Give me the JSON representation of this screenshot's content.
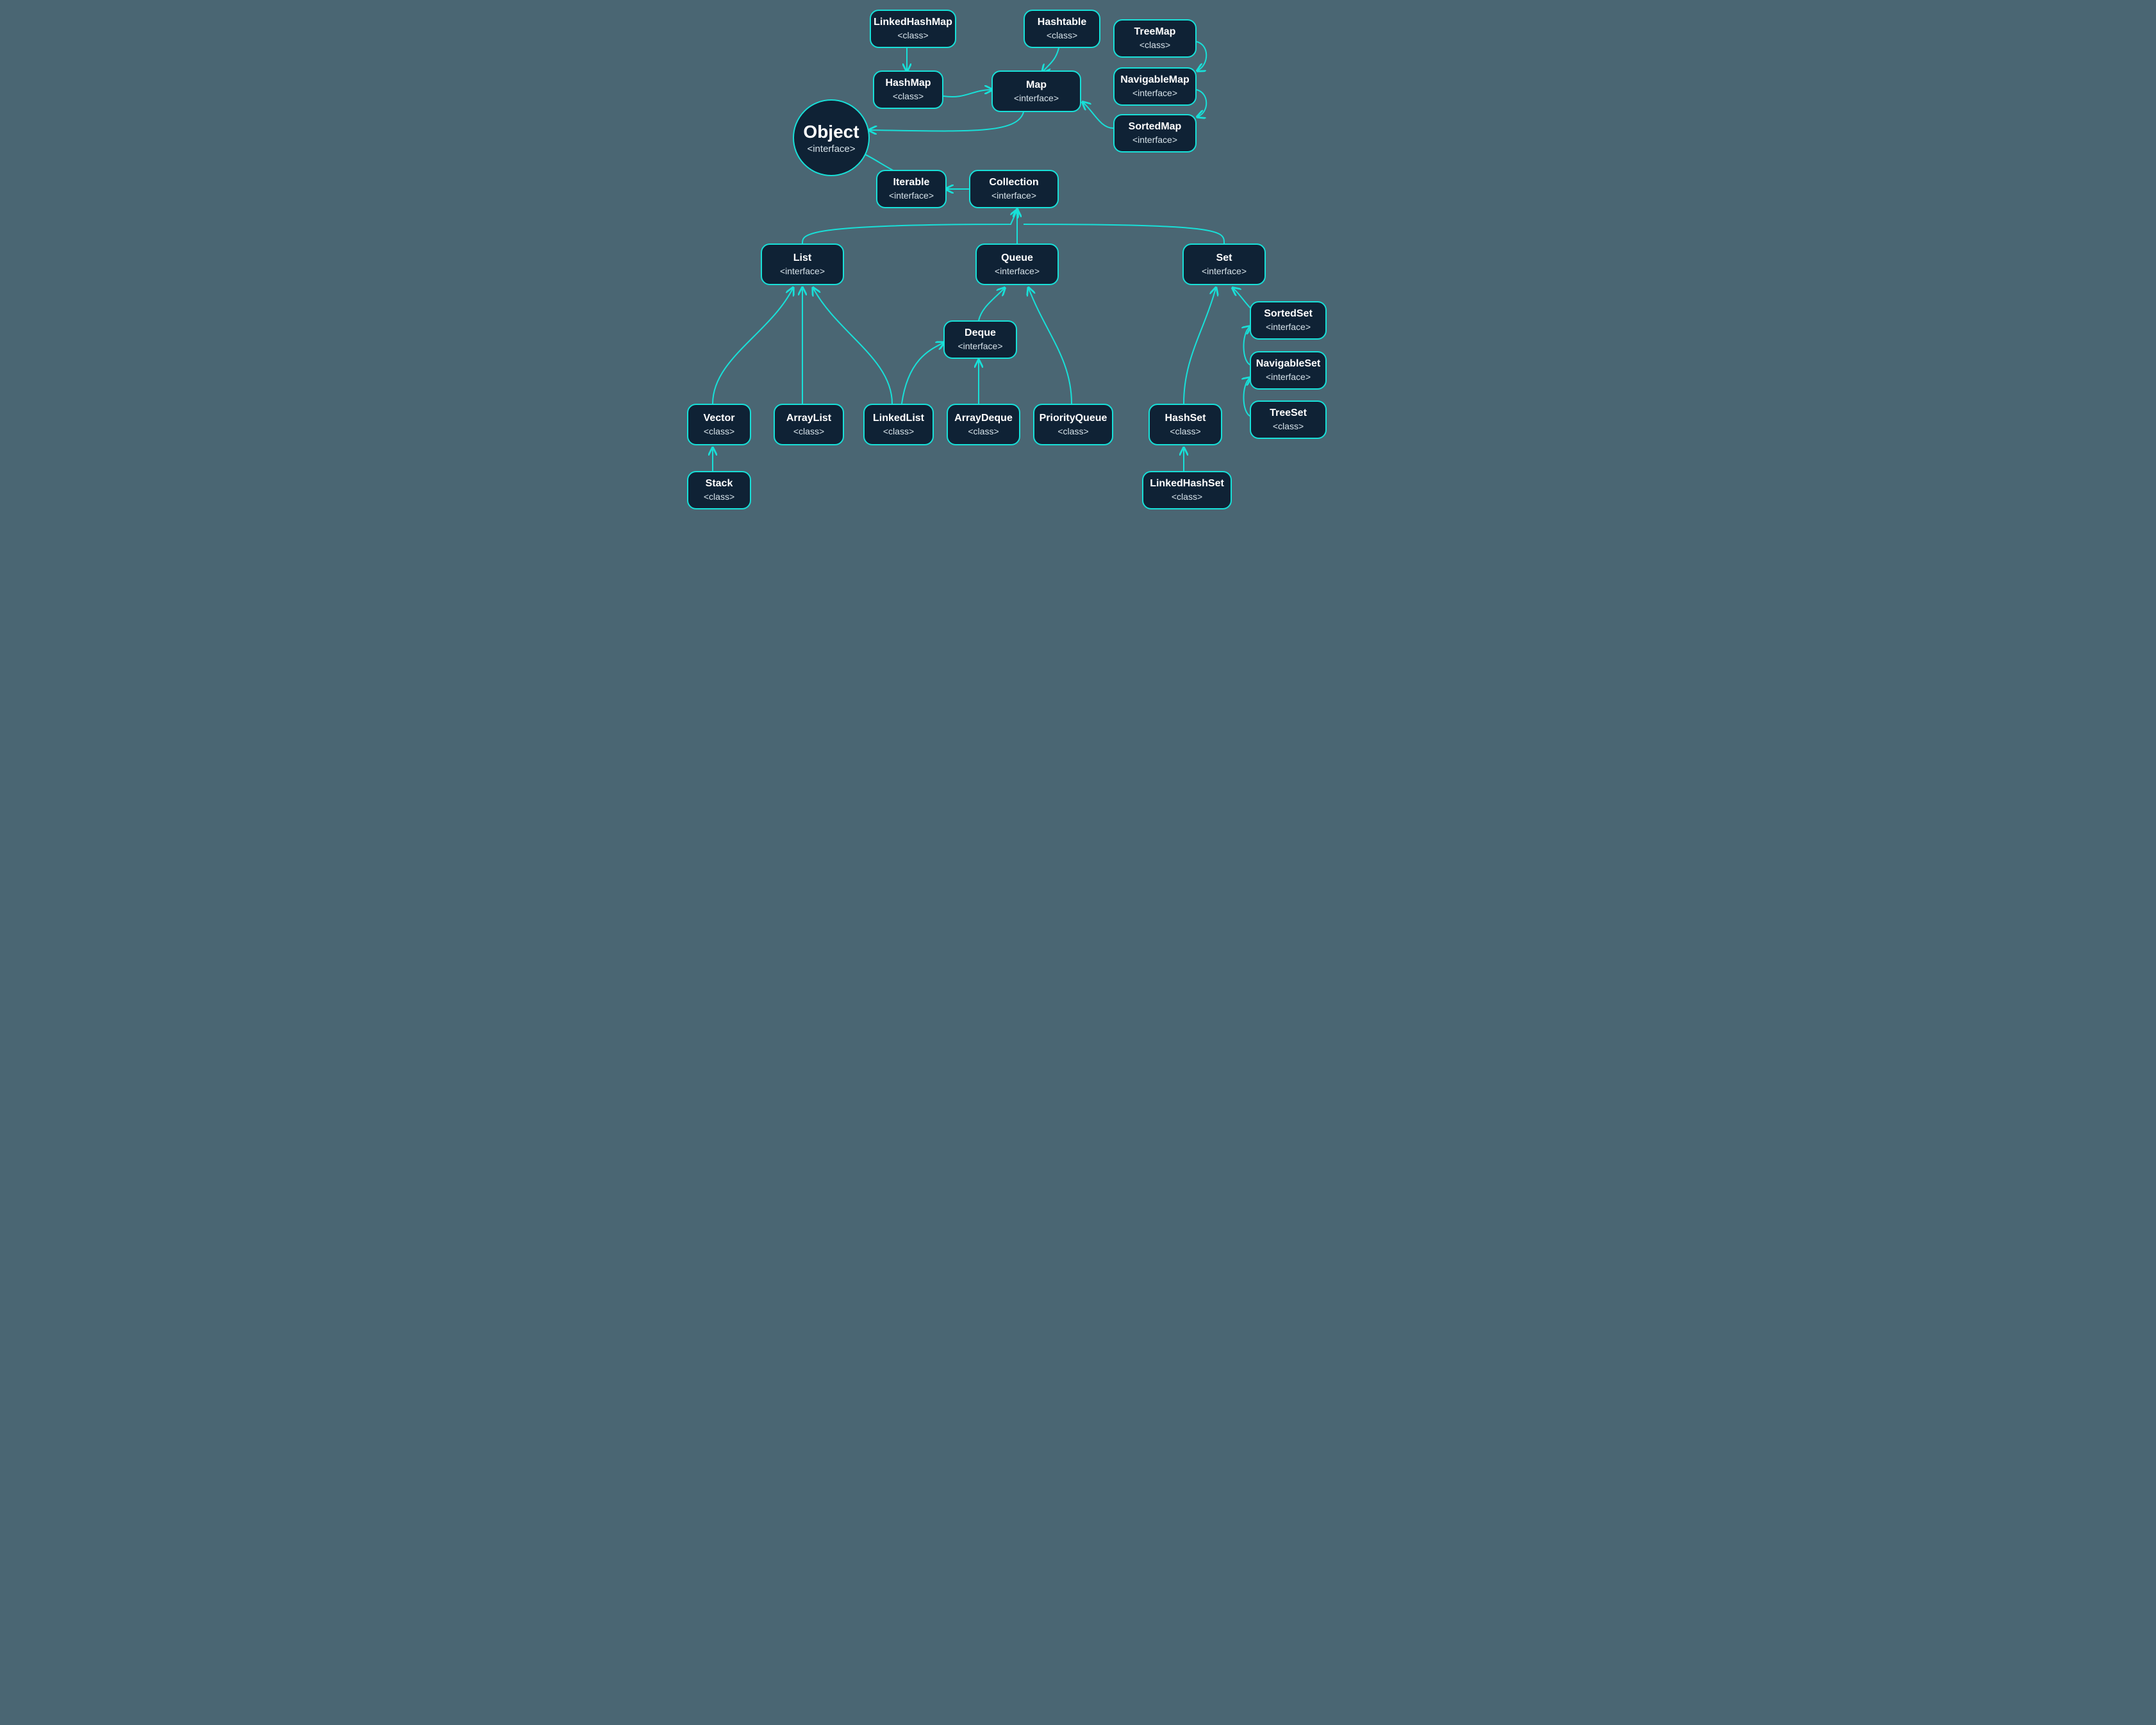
{
  "colors": {
    "bg": "#4a6673",
    "nodeFill": "#0f2235",
    "accent": "#18e0d8"
  },
  "rootCircle": {
    "title": "Object",
    "stereo": "<interface>"
  },
  "nodes": {
    "linkedHashMap": {
      "title": "LinkedHashMap",
      "stereo": "<class>"
    },
    "hashMap": {
      "title": "HashMap",
      "stereo": "<class>"
    },
    "hashtable": {
      "title": "Hashtable",
      "stereo": "<class>"
    },
    "map": {
      "title": "Map",
      "stereo": "<interface>"
    },
    "treeMap": {
      "title": "TreeMap",
      "stereo": "<class>"
    },
    "navigableMap": {
      "title": "NavigableMap",
      "stereo": "<interface>"
    },
    "sortedMap": {
      "title": "SortedMap",
      "stereo": "<interface>"
    },
    "iterable": {
      "title": "Iterable",
      "stereo": "<interface>"
    },
    "collection": {
      "title": "Collection",
      "stereo": "<interface>"
    },
    "list": {
      "title": "List",
      "stereo": "<interface>"
    },
    "queue": {
      "title": "Queue",
      "stereo": "<interface>"
    },
    "set": {
      "title": "Set",
      "stereo": "<interface>"
    },
    "deque": {
      "title": "Deque",
      "stereo": "<interface>"
    },
    "vector": {
      "title": "Vector",
      "stereo": "<class>"
    },
    "arrayList": {
      "title": "ArrayList",
      "stereo": "<class>"
    },
    "linkedList": {
      "title": "LinkedList",
      "stereo": "<class>"
    },
    "arrayDeque": {
      "title": "ArrayDeque",
      "stereo": "<class>"
    },
    "priorityQueue": {
      "title": "PriorityQueue",
      "stereo": "<class>"
    },
    "hashSet": {
      "title": "HashSet",
      "stereo": "<class>"
    },
    "treeSet": {
      "title": "TreeSet",
      "stereo": "<class>"
    },
    "sortedSet": {
      "title": "SortedSet",
      "stereo": "<interface>"
    },
    "navigableSet": {
      "title": "NavigableSet",
      "stereo": "<interface>"
    },
    "stack": {
      "title": "Stack",
      "stereo": "<class>"
    },
    "linkedHashSet": {
      "title": "LinkedHashSet",
      "stereo": "<class>"
    }
  },
  "edges_description": "Directed edges (child → parent / implements): LinkedHashMap→HashMap, HashMap→Map, Hashtable→Map, TreeMap→NavigableMap, NavigableMap→SortedMap, SortedMap→Map, Map→Object, Collection→Iterable, Iterable→Object, List→Collection, Queue→Collection, Set→Collection, Vector→List, ArrayList→List, LinkedList→List, LinkedList→Deque, ArrayDeque→Deque, Deque→Queue, PriorityQueue→Queue, HashSet→Set, SortedSet→Set, NavigableSet→SortedSet, TreeSet→NavigableSet, Stack→Vector, LinkedHashSet→HashSet"
}
